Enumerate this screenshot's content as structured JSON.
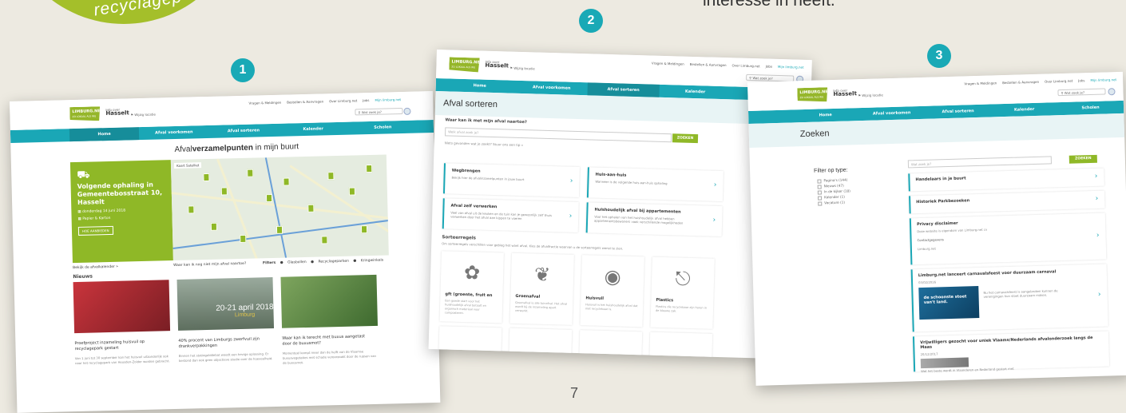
{
  "overlay": {
    "circle_text": "recyclagep",
    "intro_text": "interesse in heeft.",
    "step1": "1",
    "step2": "2",
    "step3": "3",
    "page_number": "7"
  },
  "site": {
    "logo": "LIMBURG.NET",
    "logo_sub": "ZO LOKAAL ALS WIJ",
    "info_over": "Info over",
    "city": "Hasselt",
    "change_location": "Wijzig locatie",
    "top_links": [
      "Vragen & Meldingen",
      "Bestellen & Aanvragen",
      "Over Limburg.net",
      "Jobs",
      "Mijn limburg.net"
    ],
    "search_placeholder": "Wat zoek je?",
    "nav": [
      "Home",
      "Afval voorkomen",
      "Afval sorteren",
      "Kalender",
      "Scholen"
    ]
  },
  "shot1": {
    "map_title_prefix": "Afval",
    "map_title_bold": "verzamelpunten",
    "map_title_suffix": " in mijn buurt",
    "card_title": "Volgende ophaling in Gemeentebosstraat 10, Hasselt",
    "card_date": "donderdag 14 juni 2018",
    "card_type": "Papier & Karton",
    "card_button": "HOE AANBIEDEN",
    "map_tabs": "Kaart   Satelliet",
    "calendar_link": "Bekijk de afvalkalender »",
    "map_question": "Waar kan ik nog niet mijn afval naartoe?",
    "filters": [
      "Filters",
      "Glasbollen",
      "Recyclageparken",
      "Kringwinkels"
    ],
    "news_heading": "Nieuws",
    "news": [
      {
        "title": "Proefproject inzameling huisvuil op recyclagepark gestart",
        "text": "Van 1 juni tot 30 september kan het huisvuil uitzonderlijk ook naar het recyclagepark van Heusden-Zolder worden gebracht."
      },
      {
        "title": "40% procent van Limburgs zwerfvuil zijn drankverpakkingen",
        "text": "Binnen het statiegelddebat woedt een hevige oplossing. Er bestond dan ook geen objectieve studie over de hoeveelheid."
      },
      {
        "title": "Waar kan ik terecht met buxus aangetast door de buxusmot?",
        "text": "Momenteel kampt meer dan de helft van de Vlaamse buxusvegetaties met schade veroorzaakt door de rupsen van de buxusmot."
      }
    ],
    "event_title": "20-21 april 2018",
    "event_place": "Limburg"
  },
  "shot2": {
    "page_title": "Afval sorteren",
    "question": "Waar kan ik met mijn afval naartoe?",
    "input_placeholder": "Welk afval zoek je?",
    "button": "ZOEKEN",
    "hint": "Niets gevonden wat je zoekt? Stuur ons een tip »",
    "cards": [
      {
        "title": "Wegbrengen",
        "text": "Bekijk hier de afvalinzamelpunten in jouw buurt"
      },
      {
        "title": "Huis-aan-huis",
        "text": "Wanneer is de volgende huis-aan-huis ophaling"
      },
      {
        "title": "Afval zelf verwerken",
        "text": "Veel van afval uit de keuken en de tuin kan je gewoonlijk zelf thuis verwerken door het afval aan kippen te voeren"
      },
      {
        "title": "Huishoudelijk afval bij appartementen",
        "text": "Voor het ophalen van het huishoudelijk afval hebben appartementsbewoners vaak verschillende mogelijkheden"
      }
    ],
    "sort_title": "Sorteerregels",
    "sort_desc": "Om sorteerregels verschillen voor gebieg het want afval. Kies de afvalfractie waarvan u de sorteerregels wenst te zien.",
    "tiles": [
      {
        "title": "gft (groente, fruit en",
        "text": "Een goede start voor het huishoudelijk afval betaalt en organisch materiaal voor composteren."
      },
      {
        "title": "Groenafval",
        "text": "Groenafval is alle tuinafval. Het afval wordt bij de inzameling apart verwerkt."
      },
      {
        "title": "Huisvuil",
        "text": "Huisvuil is het huishoudelijk afval dat niet recyclebaar is."
      },
      {
        "title": "Plastics",
        "text": "Plastics die recyclebaar zijn horen in de blauwe zak."
      }
    ]
  },
  "shot3": {
    "page_title": "Zoeken",
    "filter_title": "Filter op type:",
    "filters": [
      "Pagina's (144)",
      "Nieuws (47)",
      "In de kijker (18)",
      "Kalender (1)",
      "Vacature (1)"
    ],
    "input_placeholder": "Wat zoek je?",
    "button": "ZOEKEN",
    "results": [
      {
        "title": "Handelaars in je buurt",
        "text": ""
      },
      {
        "title": "Historiek Parkbezoeken",
        "text": ""
      },
      {
        "title": "Privacy disclaimer",
        "text": "Deze website is eigendom van Limburg.net cv",
        "extra": "Contactgegevens",
        "extra2": "Limburg.net"
      },
      {
        "title": "Limburg.net lanceert carnavalsfeest voor duurzaam carnaval",
        "text": "03/02/2016",
        "banner": "de schoonste stoet van't land.",
        "body": "Nu het carnavalsfeest is aangebroken kunnen de verenigingen hun stoet duurzaam maken."
      },
      {
        "title": "Vrijwilligers gezocht voor uniek Vlaams/Nederlands afvalonderzoek langs de Maas",
        "text": "20/12/2017",
        "body": "Wat het beste wordt in Vlaanderen en Nederland gestart met"
      }
    ]
  },
  "colors": {
    "teal": "#1aa7b6",
    "lime": "#a4bf2a",
    "green_card": "#8fb827",
    "background": "#edeae1"
  }
}
